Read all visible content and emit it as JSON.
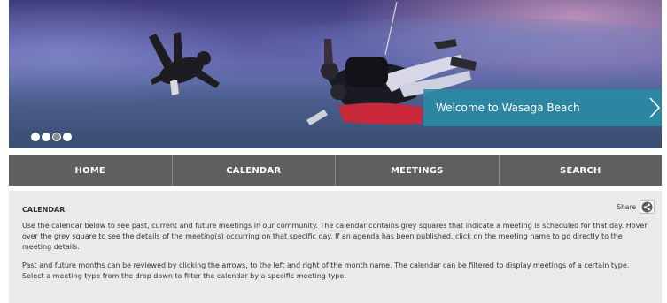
{
  "hero": {
    "banner_text": "Welcome to Wasaga Beach",
    "slides": [
      {
        "name": "slide-1",
        "active": false
      },
      {
        "name": "slide-2",
        "active": false
      },
      {
        "name": "slide-3",
        "active": true
      },
      {
        "name": "slide-4",
        "active": false
      }
    ],
    "next_icon": "chevron-right-icon",
    "colors": {
      "banner": "#288ca5",
      "sky_top": "#3d3a7a",
      "horizon_glow": "#e0a8c8"
    }
  },
  "nav": {
    "items": [
      {
        "label": "HOME"
      },
      {
        "label": "CALENDAR"
      },
      {
        "label": "MEETINGS"
      },
      {
        "label": "SEARCH"
      }
    ],
    "colors": {
      "background": "#5f5f5f",
      "text": "#ffffff"
    }
  },
  "content": {
    "title": "CALENDAR",
    "share_label": "Share",
    "share_icon": "share-icon",
    "paragraphs": [
      "Use the calendar below to see past, current and future meetings in our community. The calendar contains grey squares that indicate a meeting is scheduled for that day. Hover over the grey square to see the details of the meeting(s) occurring on that specific day. If an agenda has been published, click on the meeting name to go directly to the meeting details.",
      "Past and future months can be reviewed by clicking the arrows, to the left and right of the month name. The calendar can be filtered to display meetings of a certain type. Select a meeting type from the drop down to filter the calendar by a specific meeting type."
    ],
    "colors": {
      "background": "#eaeaea",
      "text": "#333333"
    }
  }
}
